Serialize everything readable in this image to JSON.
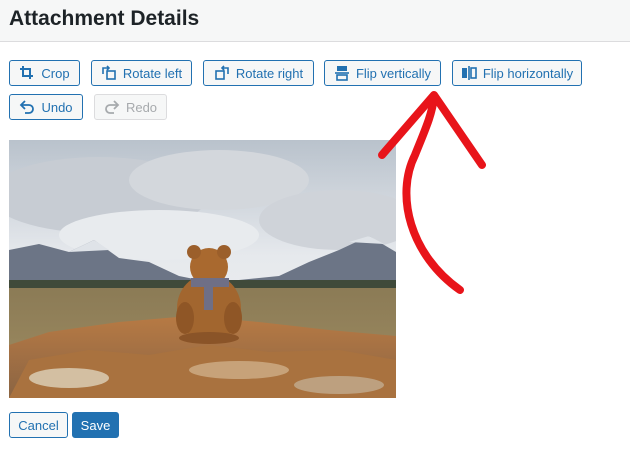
{
  "header": {
    "title": "Attachment Details"
  },
  "toolbar": {
    "crop": "Crop",
    "rotate_left": "Rotate left",
    "rotate_right": "Rotate right",
    "flip_vertically": "Flip vertically",
    "flip_horizontally": "Flip horizontally",
    "undo": "Undo",
    "redo": "Redo"
  },
  "footer": {
    "cancel": "Cancel",
    "save": "Save"
  },
  "colors": {
    "accent": "#2271b1",
    "annotation": "#e8141a"
  },
  "icons": [
    "crop-icon",
    "rotate-left-icon",
    "rotate-right-icon",
    "flip-vertical-icon",
    "flip-horizontal-icon",
    "undo-icon",
    "redo-icon"
  ]
}
